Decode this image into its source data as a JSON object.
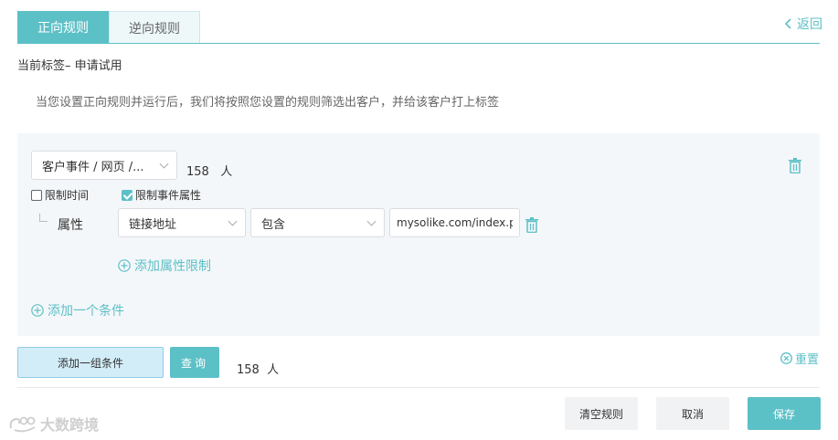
{
  "tabs": {
    "forward": "正向规则",
    "reverse": "逆向规则"
  },
  "back_label": "返回",
  "current_tag": "当前标签– 申请试用",
  "description": "当您设置正向规则并运行后，我们将按照您设置的规则筛选出客户，并给该客户打上标签",
  "rule": {
    "event_select_value": "客户事件 / 网页 /...",
    "event_count": "158   人",
    "limit_time_label": "限制时间",
    "limit_time_checked": false,
    "limit_attr_label": "限制事件属性",
    "limit_attr_checked": true,
    "attribute_label": "属性",
    "attribute_field_value": "链接地址",
    "operator_value": "包含",
    "value_input": "mysolike.com/index.ph",
    "add_attribute_label": "添加属性限制",
    "add_condition_label": "添加一个条件"
  },
  "actions": {
    "add_group_label": "添加一组条件",
    "query_label": "查询",
    "result_count": "158  人",
    "reset_label": "重置"
  },
  "footer": {
    "clear_label": "清空规则",
    "cancel_label": "取消",
    "save_label": "保存"
  },
  "watermark_text": "大数跨境",
  "colors": {
    "accent": "#5cc0c7",
    "panel_bg": "#f4f7f9",
    "add_group_bg": "#d3edf8"
  },
  "icons": [
    "chevron-left-icon",
    "chevron-down-icon",
    "trash-icon",
    "plus-circle-icon",
    "close-circle-icon",
    "checkbox-icon",
    "tree-connector-icon",
    "logo-icon"
  ]
}
